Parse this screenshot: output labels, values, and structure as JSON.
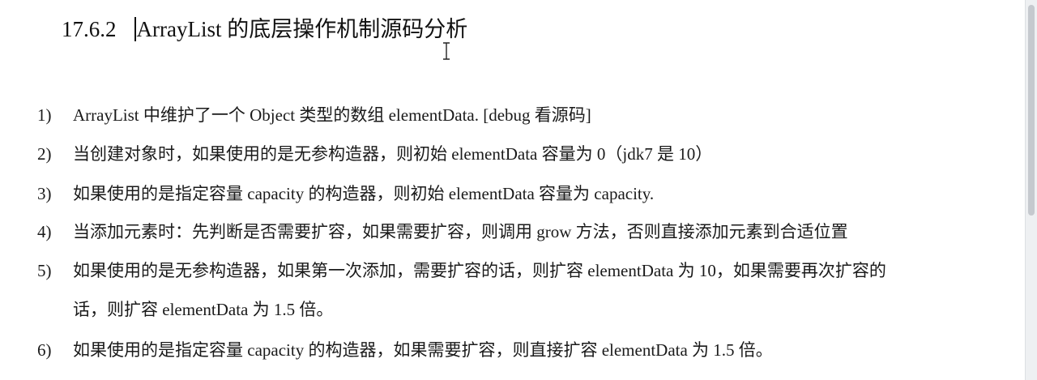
{
  "heading": {
    "number": "17.6.2",
    "title": "ArrayList 的底层操作机制源码分析"
  },
  "items": [
    {
      "index": "1)",
      "text": "ArrayList 中维护了一个 Object 类型的数组 elementData. [debug  看源码]"
    },
    {
      "index": "2)",
      "text": "当创建对象时，如果使用的是无参构造器，则初始 elementData 容量为 0（jdk7 是 10）"
    },
    {
      "index": "3)",
      "text": "如果使用的是指定容量 capacity 的构造器，则初始 elementData 容量为 capacity."
    },
    {
      "index": "4)",
      "text": "当添加元素时：先判断是否需要扩容，如果需要扩容，则调用 grow 方法，否则直接添加元素到合适位置"
    },
    {
      "index": "5)",
      "text": "如果使用的是无参构造器，如果第一次添加，需要扩容的话，则扩容 elementData 为 10，如果需要再次扩容的",
      "continuation": "话，则扩容 elementData 为 1.5 倍。"
    },
    {
      "index": "6)",
      "text": "如果使用的是指定容量 capacity 的构造器，如果需要扩容，则直接扩容 elementData 为 1.5 倍。"
    }
  ]
}
